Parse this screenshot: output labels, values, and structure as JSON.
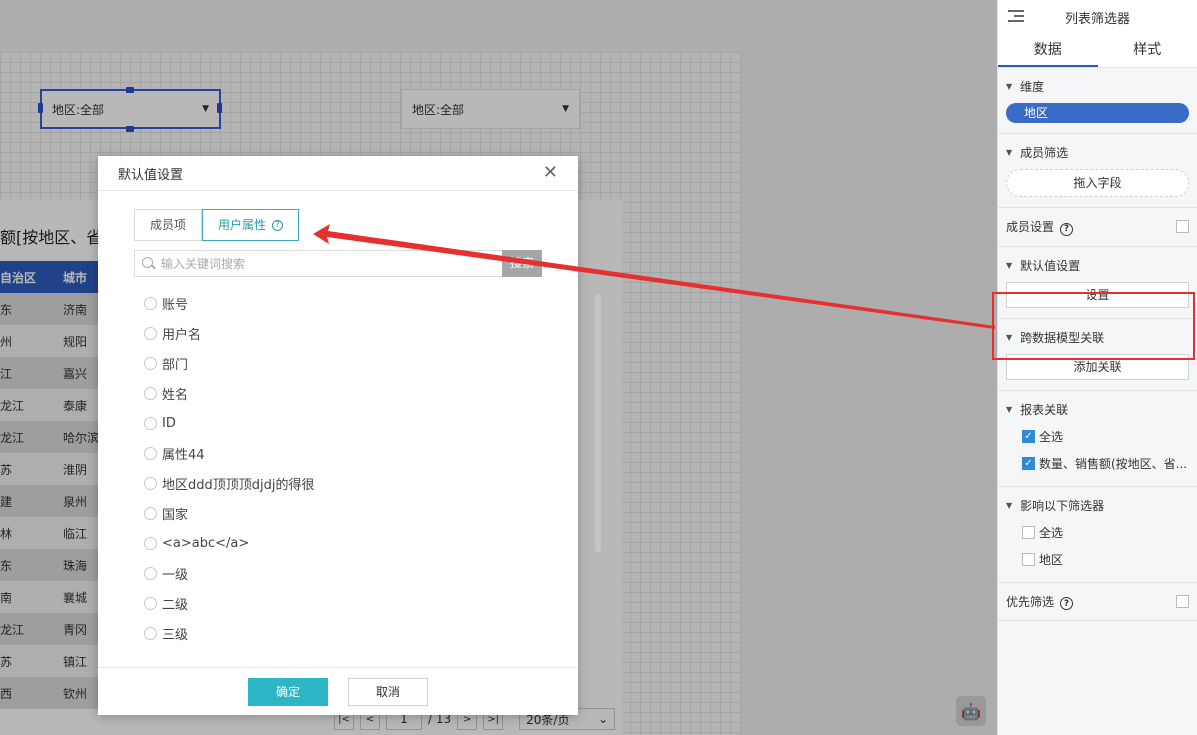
{
  "canvas": {
    "filter1": {
      "value": "地区:全部"
    },
    "filter2": {
      "value": "地区:全部"
    },
    "report": {
      "title_visible": "额[按地区、省",
      "headers": [
        "自治区",
        "城市"
      ],
      "rows": [
        [
          "东",
          "济南"
        ],
        [
          "州",
          "规阳"
        ],
        [
          "江",
          "嘉兴"
        ],
        [
          "龙江",
          "泰康"
        ],
        [
          "龙江",
          "哈尔滨"
        ],
        [
          "苏",
          "淮阴"
        ],
        [
          "建",
          "泉州"
        ],
        [
          "林",
          "临江"
        ],
        [
          "东",
          "珠海"
        ],
        [
          "南",
          "襄城"
        ],
        [
          "龙江",
          "青冈"
        ],
        [
          "苏",
          "镇江"
        ],
        [
          "西",
          "钦州"
        ]
      ]
    },
    "pagination": {
      "first": "|<",
      "prev": "<",
      "current": "1",
      "total": "/ 13",
      "next": ">",
      "last": ">|",
      "page_size": "20条/页"
    }
  },
  "dialog": {
    "title": "默认值设置",
    "tabs": [
      "成员项",
      "用户属性"
    ],
    "active_tab": "用户属性",
    "search": {
      "placeholder": "输入关键词搜索",
      "button": "搜索"
    },
    "options": [
      "账号",
      "用户名",
      "部门",
      "姓名",
      "ID",
      "属性44",
      "地区ddd顶顶顶djdj的得很",
      "国家",
      "<a>abc</a>",
      "一级",
      "二级",
      "三级"
    ],
    "ok": "确定",
    "cancel": "取消"
  },
  "panel": {
    "title": "列表筛选器",
    "tabs": [
      "数据",
      "样式"
    ],
    "dimension": {
      "title": "维度",
      "field": "地区"
    },
    "member_filter": {
      "title": "成员筛选",
      "drop": "拖入字段"
    },
    "member_settings": {
      "label": "成员设置"
    },
    "default_value": {
      "title": "默认值设置",
      "button": "设置"
    },
    "cross_model": {
      "title": "跨数据模型关联",
      "button": "添加关联"
    },
    "report_link": {
      "title": "报表关联",
      "items": [
        "全选",
        "数量、销售额(按地区、省..."
      ]
    },
    "affect": {
      "title": "影响以下筛选器",
      "items": [
        "全选",
        "地区"
      ]
    },
    "priority": {
      "label": "优先筛选"
    }
  },
  "colors": {
    "accent": "#2cb5c4",
    "brand_blue": "#2f5bbd",
    "annotation_red": "#e62f2f"
  }
}
